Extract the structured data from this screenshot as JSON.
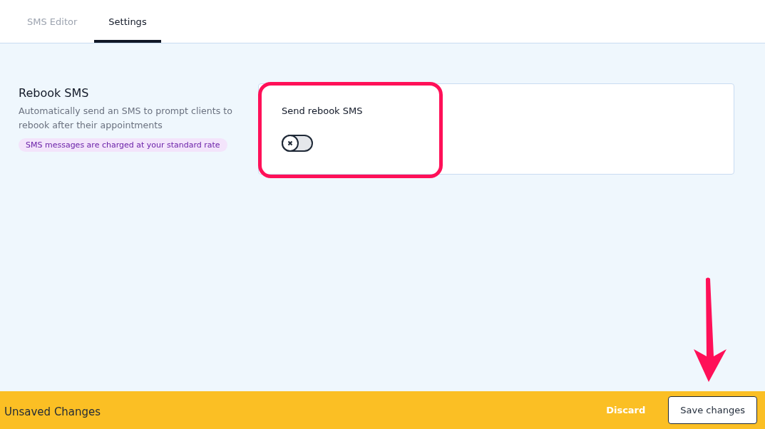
{
  "tabs": [
    {
      "label": "SMS Editor",
      "selected": false
    },
    {
      "label": "Settings",
      "selected": true
    }
  ],
  "section": {
    "title": "Rebook SMS",
    "description": "Automatically send an SMS to prompt clients to rebook after their appointments",
    "note": "SMS messages are charged at your standard rate"
  },
  "setting": {
    "label": "Send rebook SMS",
    "on": false
  },
  "footer": {
    "message": "Unsaved Changes",
    "discard": "Discard",
    "save": "Save changes"
  }
}
